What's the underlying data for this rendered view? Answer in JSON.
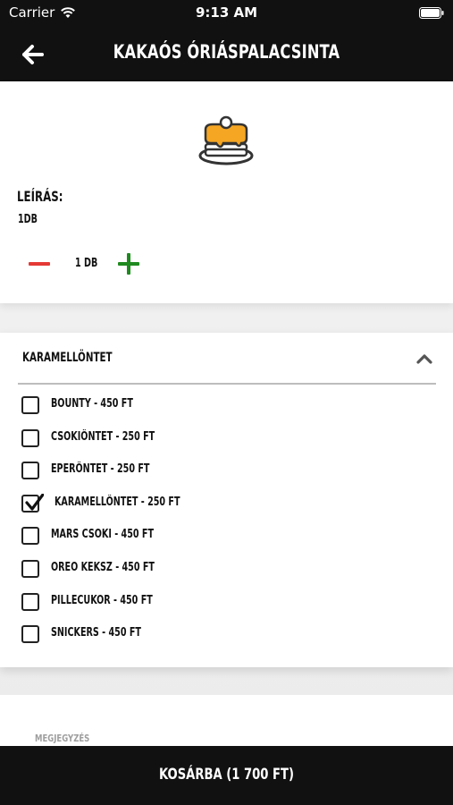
{
  "status_bar": {
    "carrier": "Carrier",
    "time": "9:13 AM"
  },
  "header": {
    "title": "KAKAÓS ÓRIÁSPALACSINTA",
    "back_icon": "arrow-left-icon"
  },
  "product": {
    "icon": "pancake-icon",
    "description_label": "LEÍRÁS:",
    "description_value": "1DB",
    "quantity_label": "1 DB"
  },
  "options": {
    "title": "KARAMELLÖNTET",
    "expanded": true,
    "items": [
      {
        "label": "BOUNTY - 450 FT",
        "checked": false
      },
      {
        "label": "CSOKIÖNTET - 250 FT",
        "checked": false
      },
      {
        "label": "EPERÖNTET - 250 FT",
        "checked": false
      },
      {
        "label": "KARAMELLÖNTET - 250 FT",
        "checked": true
      },
      {
        "label": "MARS CSOKI - 450 FT",
        "checked": false
      },
      {
        "label": "OREO KEKSZ - 450 FT",
        "checked": false
      },
      {
        "label": "PILLECUKOR - 450 FT",
        "checked": false
      },
      {
        "label": "SNICKERS - 450 FT",
        "checked": false
      }
    ]
  },
  "note": {
    "label": "MEGJEGYZÉS"
  },
  "cart": {
    "label": "KOSÁRBA (1 700 FT)"
  },
  "colors": {
    "bar": "#111111",
    "minus": "#e53935",
    "plus": "#1f8a1f",
    "pancake": "#f5a623"
  }
}
